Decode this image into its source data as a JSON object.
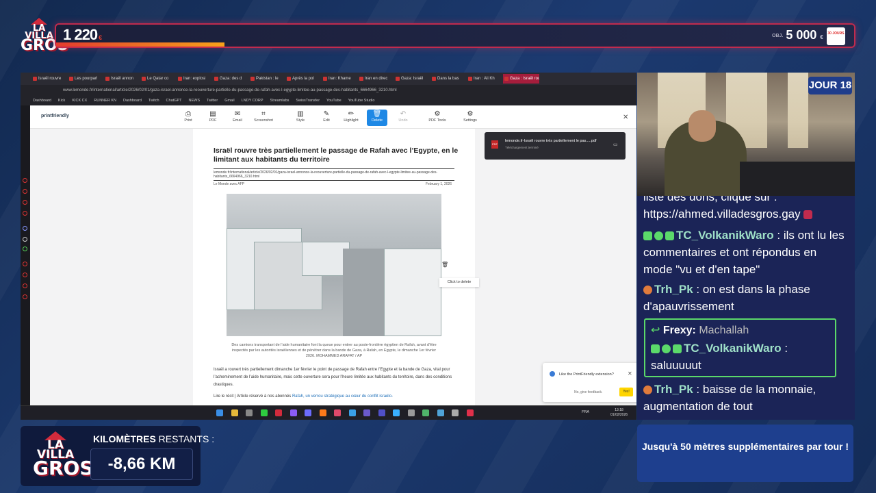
{
  "top_bar": {
    "current": "1 220",
    "currency": "€",
    "goal_prefix": "OBJ.",
    "goal": "5 000",
    "goal_currency": "€",
    "right_logo": "30 JOURS",
    "progress_fraction": 0.21
  },
  "logo": {
    "line1": "LA VILLA",
    "line2": "GROS"
  },
  "browser": {
    "tabs": [
      "Israël rouvre",
      "Les pourparl",
      "Israël annon",
      "Le Qatar co",
      "Iran: explosi",
      "Gaza: des d",
      "Pakistan : le",
      "Après la pol",
      "Iran: Khame",
      "Iran en direc",
      "Gaza: Israël",
      "Dans la bas",
      "Iran : Ali Kh",
      "Gaza : Israël rouvre trè"
    ],
    "address": "www.lemonde.fr/international/article/2026/02/01/gaza-israel-annonce-la-reouverture-partielle-du-passage-de-rafah-avec-l-egypte-limitee-au-passage-des-habitants_6664966_3210.html",
    "bookmarks": [
      "Dashboard",
      "Kick",
      "KICK CX",
      "RUNNER KN",
      "Dashboard",
      "Twitch",
      "ChatGPT",
      "NEWS",
      "Twitter",
      "Gmail",
      "LNDY CORP",
      "Streamlabs",
      "SwissTransfer",
      "YouTube",
      "YouTube Studio"
    ],
    "printfriendly": {
      "brand": "printfriendly",
      "tools": [
        "Print",
        "PDF",
        "Email",
        "Screenshot",
        "Style",
        "Edit",
        "Highlight",
        "Delete",
        "Undo",
        "PDF Tools",
        "Settings"
      ]
    },
    "article": {
      "title": "Israël rouvre très partiellement le passage de Rafah avec l’Egypte, en le limitant aux habitants du territoire",
      "url": "lemonde.fr/international/article/2026/02/01/gaza-israel-annonce-la-reouverture-partielle-du-passage-de-rafah-avec-l-egypte-limitee-au-passage-des-habitants_6664966_3210.html",
      "author": "Le Monde avec AFP",
      "date": "February 1, 2026",
      "caption": "Des camions transportant de l’aide humanitaire font la queue pour entrer au poste-frontière égyptien de Rafah, avant d’être inspectés par les autorités israéliennes et de pénétrer dans la bande de Gaza, à Rafah, en Egypte, le dimanche 1er février 2026. MOHAMMED ARAFAT / AP",
      "body": "Israël a rouvert très partiellement dimanche 1er février le point de passage de Rafah entre l’Egypte et la bande de Gaza, vital pour l’acheminement de l’aide humanitaire, mais cette ouverture sera pour l’heure limitée aux habitants du territoire, dans des conditions drastiques.",
      "read_more_prefix": "Lire le récit | Article réservé à nos abonnés",
      "read_more_link": "Rafah, un verrou stratégique au cœur du conflit israélo-"
    },
    "click_to_delete": "Click to delete",
    "download": {
      "name": "lemonde.fr-Israël rouvre très partiellement le pas.....pdf",
      "status": "Téléchargement terminé"
    },
    "ext_popup": {
      "question": "Like the PrintFriendly extension?",
      "no": "No, give feedback.",
      "yes": "Yes!"
    },
    "taskbar": {
      "lang": "FRA",
      "time": "13:18",
      "date": "01/02/2026"
    }
  },
  "webcam": {
    "day_label": "JOUR 18"
  },
  "chat": [
    {
      "user": "",
      "text": "liste des dons, clique sur :"
    },
    {
      "user": "",
      "text": "https://ahmed.villadesgros.gay"
    },
    {
      "user": "TC_VolkanikWaro",
      "text": "ils ont lu les commentaires et ont répondus en mode \"vu et d'en tape\""
    },
    {
      "user": "Trh_Pk",
      "text": "on est dans la phase d'apauvrissement"
    },
    {
      "user": "Frexy:",
      "text": "Machallah"
    },
    {
      "user": "TC_VolkanikWaro",
      "text": "saluuuuut"
    },
    {
      "user": "Trh_Pk",
      "text": "baisse de la monnaie, augmentation de tout"
    }
  ],
  "colors": {
    "accent_red": "#c12b4e",
    "username": "#9fe0c8",
    "reply_border": "#5bd96a"
  },
  "km": {
    "title_bold": "KILOMÈTRES",
    "title_rest": "RESTANTS :",
    "value": "-8,66 KM"
  },
  "info": {
    "text": "Jusqu'à 50 mètres supplémentaires par tour !"
  }
}
